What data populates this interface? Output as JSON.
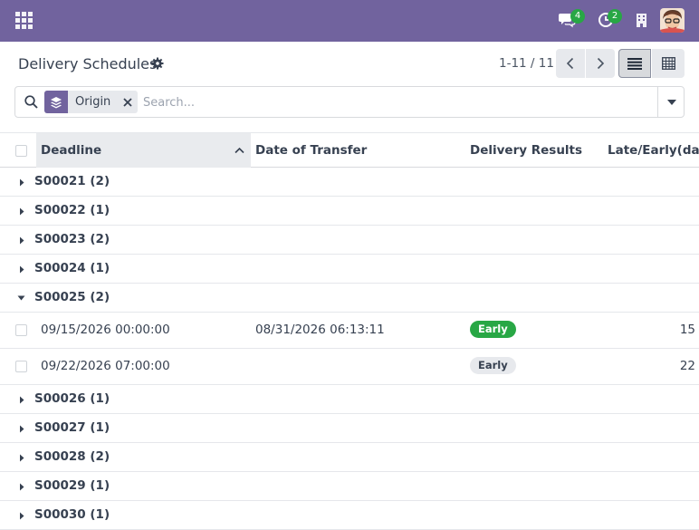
{
  "topbar": {
    "messages_badge": "4",
    "activities_badge": "2",
    "colors": {
      "brand": "#71639e",
      "badge": "#28a745"
    }
  },
  "control_panel": {
    "title": "Delivery Schedules",
    "pager": "1-11 / 11"
  },
  "search": {
    "facet_label": "Origin",
    "placeholder": "Search..."
  },
  "table": {
    "headers": [
      "Deadline",
      "Date of Transfer",
      "Delivery Results",
      "Late/Early(day)"
    ],
    "groups": [
      {
        "label": "S00021 (2)",
        "expanded": false
      },
      {
        "label": "S00022 (1)",
        "expanded": false
      },
      {
        "label": "S00023 (2)",
        "expanded": false
      },
      {
        "label": "S00024 (1)",
        "expanded": false
      },
      {
        "label": "S00025 (2)",
        "expanded": true
      },
      {
        "label": "S00026 (1)",
        "expanded": false
      },
      {
        "label": "S00027 (1)",
        "expanded": false
      },
      {
        "label": "S00028 (2)",
        "expanded": false
      },
      {
        "label": "S00029 (1)",
        "expanded": false
      },
      {
        "label": "S00030 (1)",
        "expanded": false
      }
    ],
    "rows": [
      {
        "deadline": "09/15/2026 00:00:00",
        "date_of_transfer": "08/31/2026 06:13:11",
        "result": "Early",
        "result_style": "green",
        "days": "15"
      },
      {
        "deadline": "09/22/2026 07:00:00",
        "date_of_transfer": "",
        "result": "Early",
        "result_style": "grey",
        "days": "22"
      }
    ]
  }
}
